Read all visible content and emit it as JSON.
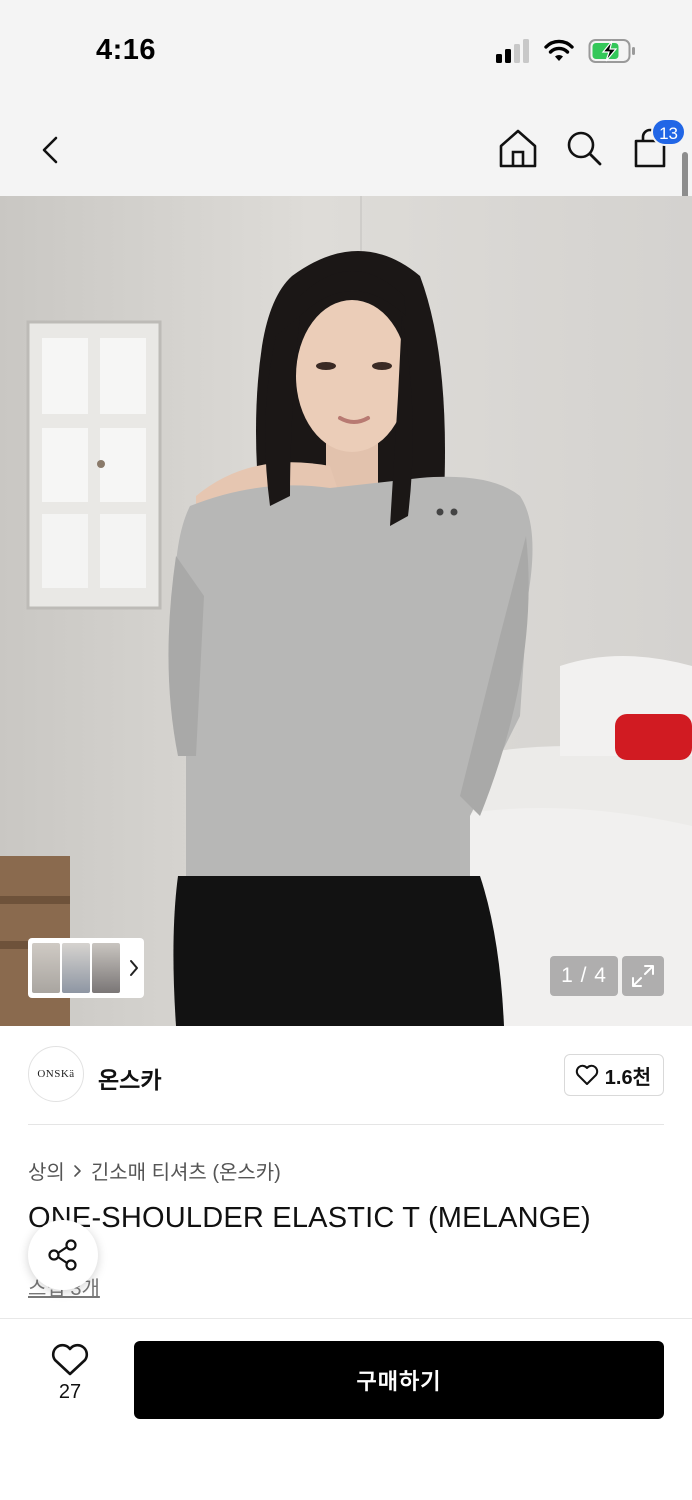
{
  "status_bar": {
    "time": "4:16",
    "battery_state": "charging",
    "battery_color": "#34c759"
  },
  "nav": {
    "cart_count": "13",
    "badge_color": "#2166e6"
  },
  "gallery": {
    "page_indicator": "1 / 4"
  },
  "brand": {
    "logo_text": "ONSKä",
    "name": "온스카",
    "like_count": "1.6천"
  },
  "breadcrumb": {
    "category": "상의",
    "subcategory": "긴소매 티셔츠 (온스카)"
  },
  "product": {
    "title": "ONE-SHOULDER ELASTIC T (MELANGE)",
    "review_link": "스냅 3개"
  },
  "bottom_bar": {
    "wish_count": "27",
    "buy_label": "구매하기"
  }
}
